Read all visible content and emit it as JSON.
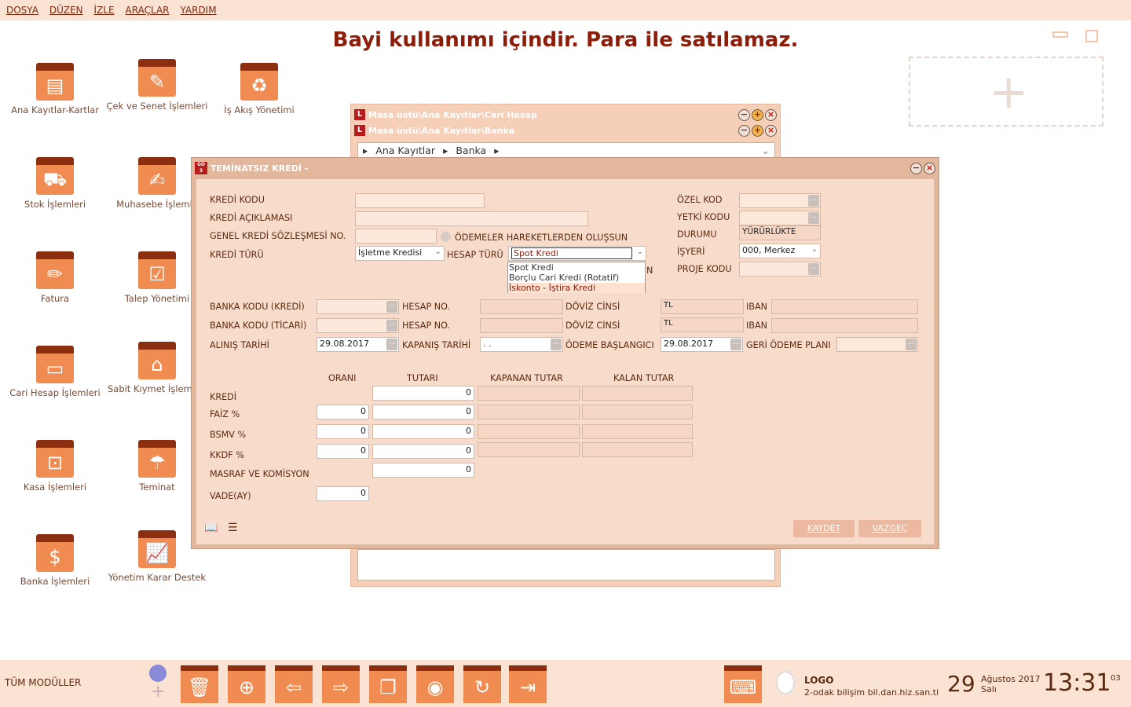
{
  "menu": [
    "DOSYA",
    "DÜZEN",
    "İZLE",
    "ARAÇLAR",
    "YARDIM"
  ],
  "banner": "Bayi kullanımı içindir. Para ile satılamaz.",
  "desktop_icons": [
    {
      "label": "Ana Kayıtlar-Kartlar",
      "icon": "folders-icon",
      "glyph": "▤"
    },
    {
      "label": "Çek ve Senet İşlemleri",
      "icon": "check-icon",
      "glyph": "✎"
    },
    {
      "label": "İş Akış Yönetimi",
      "icon": "workflow-icon",
      "glyph": "♻"
    },
    {
      "label": "Stok İşlemleri",
      "icon": "hand-truck-icon",
      "glyph": "⛟"
    },
    {
      "label": "Muhasebe İşlemle",
      "icon": "accounting-icon",
      "glyph": "✍"
    },
    {
      "label": "Fatura",
      "icon": "invoice-icon",
      "glyph": "✏"
    },
    {
      "label": "Talep Yönetimi",
      "icon": "request-icon",
      "glyph": "☑"
    },
    {
      "label": "Cari Hesap İşlemleri",
      "icon": "id-card-icon",
      "glyph": "▭"
    },
    {
      "label": "Sabit Kıymet İşlemleri",
      "icon": "fixed-asset-icon",
      "glyph": "⌂"
    },
    {
      "label": "Kasa İşlemleri",
      "icon": "safe-icon",
      "glyph": "⊡"
    },
    {
      "label": "Teminat",
      "icon": "umbrella-icon",
      "glyph": "☂"
    },
    {
      "label": "Banka İşlemleri",
      "icon": "bank-icon",
      "glyph": "$"
    },
    {
      "label": "Yönetim Karar Destek",
      "icon": "chart-icon",
      "glyph": "📈"
    }
  ],
  "bgwin": {
    "title1": "Masa üstü\\Ana Kayıtlar\\Cari Hesap",
    "title2": "Masa üstü\\Ana Kayıtlar\\Banka",
    "crumb1": "Ana Kayıtlar",
    "crumb2": "Banka"
  },
  "dialog": {
    "title": "TEMİNATSIZ KREDİ -",
    "labels": {
      "kredi_kodu": "KREDİ KODU",
      "kredi_aciklamasi": "KREDİ AÇIKLAMASI",
      "genel_sozlesme": "GENEL KREDİ SÖZLEŞMESİ NO.",
      "odemeler": "ÖDEMELER HAREKETLERDEN OLUŞSUN",
      "kredi_turu": "KREDİ TÜRÜ",
      "hesap_turu": "HESAP TÜRÜ",
      "ozel_kod": "ÖZEL KOD",
      "yetki_kodu": "YETKİ KODU",
      "durumu": "DURUMU",
      "isyeri": "İŞYERİ",
      "proje_kodu": "PROJE KODU",
      "banka_kredi": "BANKA KODU (KREDİ)",
      "banka_ticari": "BANKA KODU (TİCARİ)",
      "hesap_no": "HESAP NO.",
      "doviz": "DÖVİZ CİNSİ",
      "iban": "IBAN",
      "alinis": "ALINIŞ TARİHİ",
      "kapanis": "KAPANIŞ TARİHİ",
      "odeme_baslangici": "ÖDEME BAŞLANGICI",
      "geri_odeme": "GERİ ÖDEME PLANI",
      "orani": "ORANI",
      "tutari": "TUTARI",
      "kapanan": "KAPANAN TUTAR",
      "kalan": "KALAN TUTAR",
      "kredi": "KREDİ",
      "faiz": "FAİZ %",
      "bsmv": "BSMV %",
      "kkdf": "KKDF %",
      "masraf": "MASRAF VE KOMİSYON",
      "vade": "VADE(AY)"
    },
    "values": {
      "kredi_turu": "İşletme Kredisi",
      "hesap_turu": "Spot Kredi",
      "durumu": "YÜRÜRLÜKTE",
      "isyeri": "000, Merkez",
      "doviz1": "TL",
      "doviz2": "TL",
      "alinis": "29.08.2017",
      "kapanis": ". .",
      "odeme_baslangici": "29.08.2017",
      "zero": "0",
      "hidden_n": "N"
    },
    "dropdown": [
      "Spot Kredi",
      "Borçlu Cari Kredi (Rotatif)",
      "İskonto - İştira Kredi"
    ],
    "buttons": {
      "save": "KAYDET",
      "cancel": "VAZGEÇ"
    }
  },
  "taskbar": {
    "all_modules": "TÜM MODÜLLER",
    "logo": "LOGO",
    "company": "2-odak bilişim bil.dan.hiz.san.ti",
    "day": "29",
    "month": "Ağustos 2017",
    "weekday": "Salı",
    "time": "13:31",
    "seconds": "03"
  }
}
